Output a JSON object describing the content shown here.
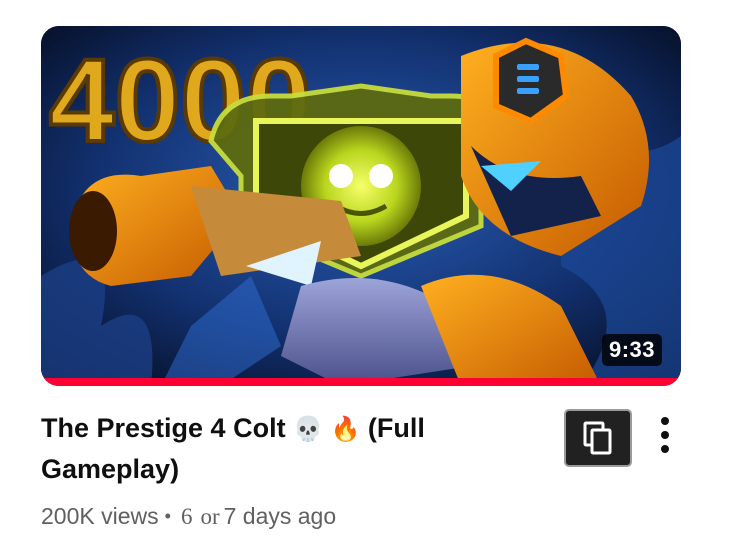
{
  "video": {
    "title": "The Prestige 4 Colt",
    "title_suffix": "(Full Gameplay)",
    "emojis": [
      "💀",
      "🔥"
    ],
    "duration": "9:33",
    "thumbnail_text": "4000",
    "watched_fraction": 1.0,
    "views": "200K views",
    "separator": "•",
    "age_part1": "6",
    "age_or": "or",
    "age_part2": "7 days ago"
  },
  "icons": {
    "copy": "copy-icon",
    "more": "more-vertical-icon"
  },
  "colors": {
    "progress": "#ff0033",
    "title": "#0f0f0f",
    "meta": "#606060",
    "badge_bg": "#000000"
  }
}
